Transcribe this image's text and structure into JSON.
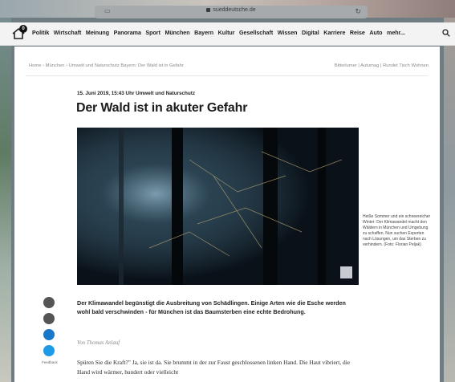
{
  "browser": {
    "url": "sueddeutsche.de"
  },
  "nav": {
    "notification_count": "0",
    "items": [
      "Politik",
      "Wirtschaft",
      "Meinung",
      "Panorama",
      "Sport",
      "München",
      "Bayern",
      "Kultur",
      "Gesellschaft",
      "Wissen",
      "Digital",
      "Karriere",
      "Reise",
      "Auto",
      "mehr..."
    ]
  },
  "breadcrumb": {
    "left": "Home › München › Umwelt und Naturschutz Bayern: Der Wald ist in Gefahr",
    "right": "Bitterlumer | Autumag | Rundet Tisch Wohnen"
  },
  "article": {
    "dateline": "15. Juni 2019, 15:43 Uhr   Umwelt und Naturschutz",
    "headline": "Der Wald ist in akuter Gefahr",
    "caption": "Heiße Sommer und ein schneereicher Winter: Der Klimawandel macht den Wäldern in München und Umgebung zu schaffen. Nun suchen Experten nach Lösungen, um das Sterben zu verhindern. (Foto: Florian Peljak)",
    "teaser": "Der Klimawandel begünstigt die Ausbreitung von Schädlingen. Einige Arten wie die Esche werden wohl bald verschwinden - für München ist das Baumsterben eine echte Bedrohung.",
    "author": "Von Thomas Anlauf",
    "body": "Spüren Sie die Kraft?\" Ja, sie ist da. Sie brummt in der zur Faust geschlossenen linken Hand. Die Haut vibriert, die Hand wird wärmer, hundert oder vielleicht"
  },
  "share": {
    "feedback_label": "Feedback"
  },
  "colors": {
    "facebook": "#1877c9",
    "twitter": "#1d9be6",
    "nav_bg": "#f3f3f3"
  }
}
